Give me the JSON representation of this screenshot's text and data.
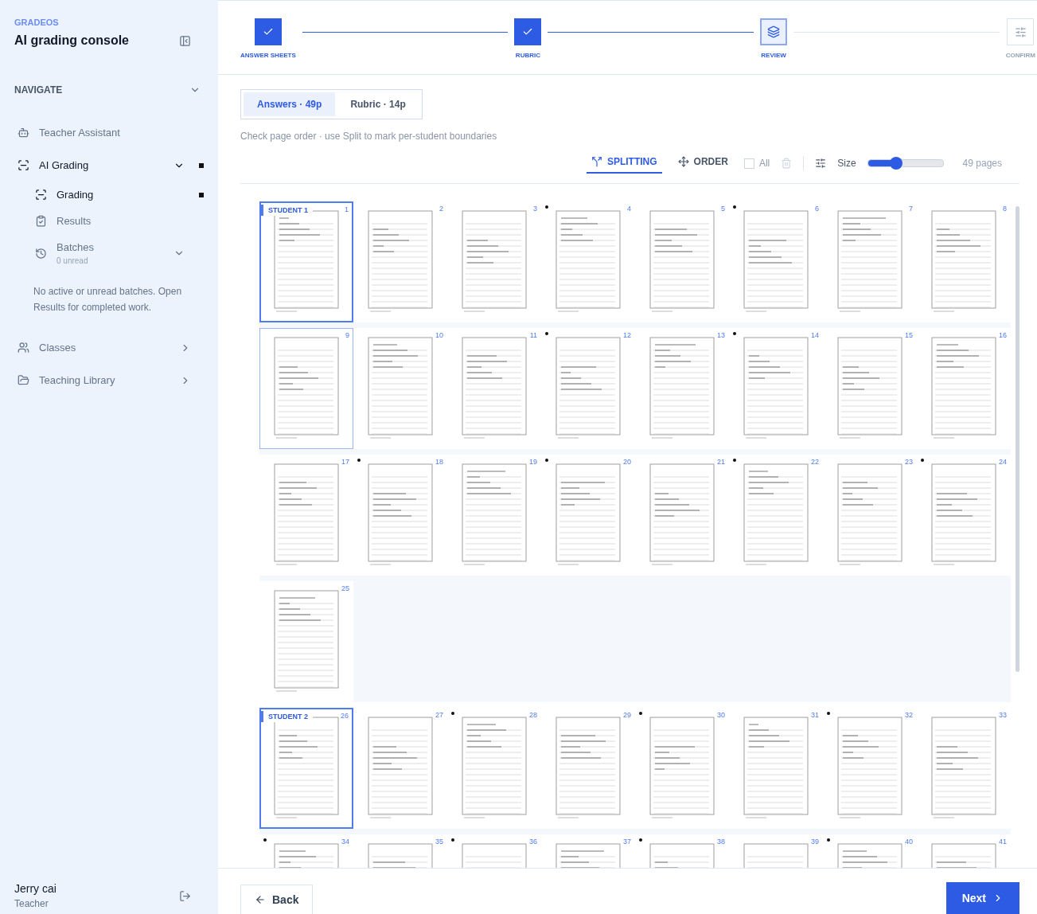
{
  "sidebar": {
    "brand": "GRADEOS",
    "title": "AI grading console",
    "section": "NAVIGATE",
    "items": [
      {
        "label": "Teacher Assistant",
        "selected": false
      },
      {
        "label": "AI Grading",
        "selected": true,
        "expanded": true,
        "children": [
          {
            "label": "Grading",
            "selected": true
          },
          {
            "label": "Results",
            "selected": false
          },
          {
            "label": "Batches",
            "sub": "0 unread",
            "selected": false,
            "expanded": true
          }
        ]
      },
      {
        "label": "Classes",
        "selected": false,
        "expanded": false
      },
      {
        "label": "Teaching Library",
        "selected": false,
        "expanded": false
      }
    ],
    "note": "No active or unread batches. Open Results for completed work.",
    "user": {
      "name": "Jerry cai",
      "role": "Teacher"
    }
  },
  "steps": [
    {
      "label": "ANSWER SHEETS",
      "completed": true,
      "selected": false
    },
    {
      "label": "RUBRIC",
      "completed": true,
      "selected": false
    },
    {
      "label": "REVIEW",
      "completed": false,
      "selected": true
    },
    {
      "label": "CONFIRM",
      "completed": false,
      "selected": false
    }
  ],
  "tabs": [
    {
      "label": "Answers · 49p",
      "selected": true
    },
    {
      "label": "Rubric · 14p",
      "selected": false
    }
  ],
  "hint": "Check page order · use Split to mark per-student boundaries",
  "toolbar": {
    "modes": [
      {
        "label": "SPLITTING",
        "selected": true
      },
      {
        "label": "ORDER",
        "selected": false
      }
    ],
    "select_all": {
      "label": "All",
      "checked": false,
      "disabled": true
    },
    "size_label": "Size",
    "size": {
      "level": 0.38
    },
    "count": "49 pages"
  },
  "groups": [
    {
      "label": "STUDENT 1",
      "pages": [
        {
          "number": "1",
          "marked": false,
          "selected": false
        },
        {
          "number": "2",
          "marked": false,
          "selected": false
        },
        {
          "number": "3",
          "marked": false,
          "selected": false
        },
        {
          "number": "4",
          "marked": true,
          "selected": false
        },
        {
          "number": "5",
          "marked": false,
          "selected": false
        },
        {
          "number": "6",
          "marked": true,
          "selected": false
        },
        {
          "number": "7",
          "marked": false,
          "selected": false
        },
        {
          "number": "8",
          "marked": false,
          "selected": false
        },
        {
          "number": "9",
          "marked": false,
          "selected": true
        },
        {
          "number": "10",
          "marked": false,
          "selected": false
        },
        {
          "number": "11",
          "marked": false,
          "selected": false
        },
        {
          "number": "12",
          "marked": true,
          "selected": false
        },
        {
          "number": "13",
          "marked": false,
          "selected": false
        },
        {
          "number": "14",
          "marked": true,
          "selected": false
        },
        {
          "number": "15",
          "marked": false,
          "selected": false
        },
        {
          "number": "16",
          "marked": false,
          "selected": false
        },
        {
          "number": "17",
          "marked": false,
          "selected": false
        },
        {
          "number": "18",
          "marked": true,
          "selected": false
        },
        {
          "number": "19",
          "marked": false,
          "selected": false
        },
        {
          "number": "20",
          "marked": true,
          "selected": false
        },
        {
          "number": "21",
          "marked": false,
          "selected": false
        },
        {
          "number": "22",
          "marked": true,
          "selected": false
        },
        {
          "number": "23",
          "marked": false,
          "selected": false
        },
        {
          "number": "24",
          "marked": true,
          "selected": false
        },
        {
          "number": "25",
          "marked": false,
          "selected": false
        }
      ]
    },
    {
      "label": "STUDENT 2",
      "pages": [
        {
          "number": "26",
          "marked": false,
          "selected": false
        },
        {
          "number": "27",
          "marked": false,
          "selected": false
        },
        {
          "number": "28",
          "marked": true,
          "selected": false
        },
        {
          "number": "29",
          "marked": false,
          "selected": false
        },
        {
          "number": "30",
          "marked": true,
          "selected": false
        },
        {
          "number": "31",
          "marked": false,
          "selected": false
        },
        {
          "number": "32",
          "marked": true,
          "selected": false
        },
        {
          "number": "33",
          "marked": false,
          "selected": false
        },
        {
          "number": "34",
          "marked": true,
          "selected": false
        },
        {
          "number": "35",
          "marked": false,
          "selected": false
        },
        {
          "number": "36",
          "marked": true,
          "selected": false
        },
        {
          "number": "37",
          "marked": false,
          "selected": false
        },
        {
          "number": "38",
          "marked": true,
          "selected": false
        },
        {
          "number": "39",
          "marked": false,
          "selected": false
        },
        {
          "number": "40",
          "marked": true,
          "selected": false
        },
        {
          "number": "41",
          "marked": false,
          "selected": false
        }
      ]
    }
  ],
  "footer": {
    "back": "Back",
    "next": "Next"
  }
}
